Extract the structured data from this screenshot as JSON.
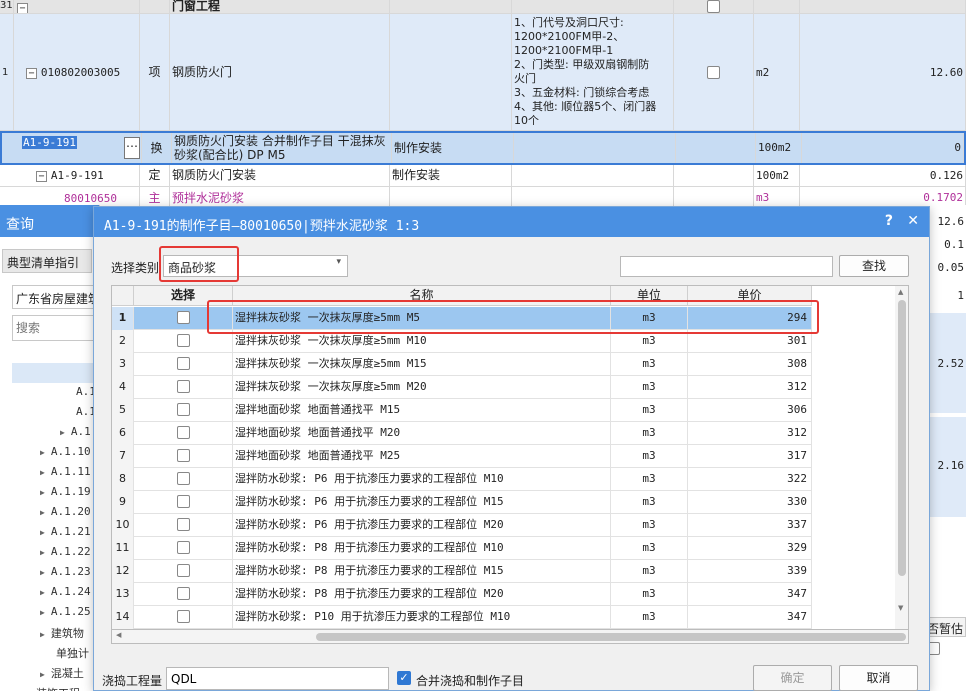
{
  "background_grid": {
    "rows": [
      {
        "num": "31",
        "code": "",
        "type": "",
        "name": "门窗工程",
        "spec": "",
        "feature": "",
        "unit": "",
        "qty": ""
      },
      {
        "num": "1",
        "code": "010802003005",
        "type": "项",
        "name": "钢质防火门",
        "spec": "",
        "feature": "1、门代号及洞口尺寸:\n1200*2100FM甲-2、\n1200*2100FM甲-1\n2、门类型: 甲级双扇钢制防\n火门\n3、五金材料: 门锁综合考虑\n4、其他: 顺位器5个、闭门器\n10个",
        "unit": "m2",
        "qty": "12.60"
      },
      {
        "num": "",
        "code": "A1-9-191",
        "type": "换",
        "name": "钢质防火门安装  合并制作子目 干混抹灰砂浆(配合比) DP M5",
        "spec": "制作安装",
        "feature": "",
        "unit": "100m2",
        "qty": "0"
      },
      {
        "num": "",
        "code": "A1-9-191",
        "type": "定",
        "name": "钢质防火门安装",
        "spec": "制作安装",
        "feature": "",
        "unit": "100m2",
        "qty": "0.126"
      },
      {
        "num": "",
        "code": "80010650",
        "type": "主",
        "name": "预拌水泥砂浆",
        "spec": "",
        "feature": "",
        "unit": "m3",
        "qty": "0.1702"
      }
    ],
    "right_values": [
      "12.6",
      "0.1",
      "0.05",
      "1",
      "2.52",
      "2.16"
    ],
    "right_label": "否暂估"
  },
  "query_panel": {
    "title": "查询",
    "tab": "典型清单指引",
    "region": "广东省房屋建筑",
    "search_placeholder": "搜索",
    "tree": [
      "A.1",
      "A.1",
      "A.1",
      "A.1.10",
      "A.1.11",
      "A.1.19",
      "A.1.20",
      "A.1.21",
      "A.1.22",
      "A.1.23",
      "A.1.24",
      "A.1.25",
      "建筑物",
      "单独计",
      "混凝土",
      "装饰工程"
    ]
  },
  "dialog": {
    "title": "A1-9-191的制作子目—80010650|预拌水泥砂浆 1:3",
    "help": "?",
    "close": "✕",
    "category_label": "选择类别",
    "category_value": "商品砂浆",
    "search_value": "",
    "search_button": "查找",
    "columns": [
      "选择",
      "名称",
      "单位",
      "单价"
    ],
    "rows": [
      {
        "idx": "1",
        "name": "湿拌抹灰砂浆 一次抹灰厚度≥5mm M5",
        "unit": "m3",
        "price": "294",
        "selected": true
      },
      {
        "idx": "2",
        "name": "湿拌抹灰砂浆 一次抹灰厚度≥5mm M10",
        "unit": "m3",
        "price": "301"
      },
      {
        "idx": "3",
        "name": "湿拌抹灰砂浆 一次抹灰厚度≥5mm M15",
        "unit": "m3",
        "price": "308"
      },
      {
        "idx": "4",
        "name": "湿拌抹灰砂浆 一次抹灰厚度≥5mm M20",
        "unit": "m3",
        "price": "312"
      },
      {
        "idx": "5",
        "name": "湿拌地面砂浆 地面普通找平 M15",
        "unit": "m3",
        "price": "306"
      },
      {
        "idx": "6",
        "name": "湿拌地面砂浆 地面普通找平 M20",
        "unit": "m3",
        "price": "312"
      },
      {
        "idx": "7",
        "name": "湿拌地面砂浆 地面普通找平 M25",
        "unit": "m3",
        "price": "317"
      },
      {
        "idx": "8",
        "name": "湿拌防水砂浆: P6 用于抗渗压力要求的工程部位 M10",
        "unit": "m3",
        "price": "322"
      },
      {
        "idx": "9",
        "name": "湿拌防水砂浆: P6 用于抗渗压力要求的工程部位 M15",
        "unit": "m3",
        "price": "330"
      },
      {
        "idx": "10",
        "name": "湿拌防水砂浆: P6 用于抗渗压力要求的工程部位 M20",
        "unit": "m3",
        "price": "337"
      },
      {
        "idx": "11",
        "name": "湿拌防水砂浆: P8 用于抗渗压力要求的工程部位 M10",
        "unit": "m3",
        "price": "329"
      },
      {
        "idx": "12",
        "name": "湿拌防水砂浆: P8 用于抗渗压力要求的工程部位 M15",
        "unit": "m3",
        "price": "339"
      },
      {
        "idx": "13",
        "name": "湿拌防水砂浆: P8 用于抗渗压力要求的工程部位 M20",
        "unit": "m3",
        "price": "347"
      },
      {
        "idx": "14",
        "name": "湿拌防水砂浆: P10 用于抗渗压力要求的工程部位 M10",
        "unit": "m3",
        "price": "347"
      }
    ],
    "pour_label": "浇捣工程量",
    "pour_value": "QDL",
    "merge_label": "合并浇捣和制作子目",
    "merge_checked": true,
    "ok_button": "确定",
    "cancel_button": "取消"
  },
  "colors": {
    "title_bar": "#4a90e2",
    "selection": "#9cc7f0",
    "highlight_box": "#e53935",
    "main_material": "#b0309a"
  }
}
